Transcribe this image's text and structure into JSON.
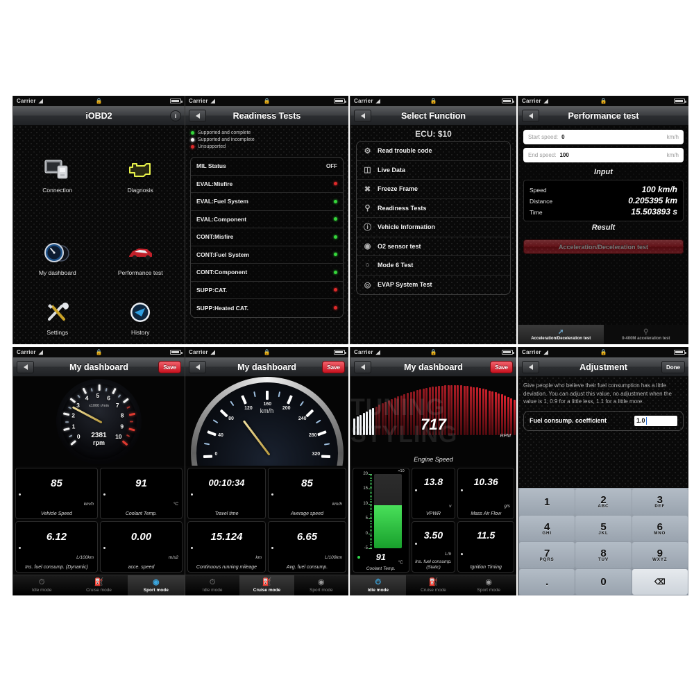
{
  "panels": {
    "home": {
      "status": {
        "carrier": "Carrier",
        "wifi": "wifi-icon",
        "lock": "lock-icon",
        "battery": "battery-icon"
      },
      "title": "iOBD2",
      "info_button": "i",
      "items": [
        {
          "label": "Connection",
          "icon": "connection-icon"
        },
        {
          "label": "Diagnosis",
          "icon": "engine-check-icon"
        },
        {
          "label": "My dashboard",
          "icon": "dashboard-gauge-icon"
        },
        {
          "label": "Performance test",
          "icon": "red-car-icon"
        },
        {
          "label": "Settings",
          "icon": "tools-icon"
        },
        {
          "label": "History",
          "icon": "history-gauge-icon"
        }
      ]
    },
    "readiness": {
      "status": {
        "carrier": "Carrier"
      },
      "title": "Readiness Tests",
      "legend": [
        {
          "label": "Supported and complete",
          "state": "g"
        },
        {
          "label": "Supported and incomplete",
          "state": "w"
        },
        {
          "label": "Unsupported",
          "state": "r"
        }
      ],
      "rows": [
        {
          "label": "MIL Status",
          "value": "OFF",
          "state": ""
        },
        {
          "label": "EVAL:Misfire",
          "value": "",
          "state": "r"
        },
        {
          "label": "EVAL:Fuel System",
          "value": "",
          "state": "g"
        },
        {
          "label": "EVAL:Component",
          "value": "",
          "state": "g"
        },
        {
          "label": "CONT:Misfire",
          "value": "",
          "state": "g"
        },
        {
          "label": "CONT:Fuel System",
          "value": "",
          "state": "g"
        },
        {
          "label": "CONT:Component",
          "value": "",
          "state": "g"
        },
        {
          "label": "SUPP:CAT.",
          "value": "",
          "state": "r"
        },
        {
          "label": "SUPP:Heated CAT.",
          "value": "",
          "state": "r"
        }
      ]
    },
    "select_function": {
      "title": "Select Function",
      "ecu": "ECU: $10",
      "items": [
        {
          "label": "Read trouble code",
          "icon": "trouble-code-icon"
        },
        {
          "label": "Live Data",
          "icon": "live-data-icon"
        },
        {
          "label": "Freeze Frame",
          "icon": "freeze-frame-icon"
        },
        {
          "label": "Readiness Tests",
          "icon": "readiness-icon"
        },
        {
          "label": "Vehicle Information",
          "icon": "vehicle-info-icon"
        },
        {
          "label": "O2 sensor test",
          "icon": "o2-sensor-icon"
        },
        {
          "label": "Mode 6 Test",
          "icon": "mode6-icon"
        },
        {
          "label": "EVAP System Test",
          "icon": "evap-icon"
        }
      ]
    },
    "performance": {
      "title": "Performance test",
      "start_speed_label": "Start speed:",
      "start_speed_value": "0",
      "start_speed_unit": "km/h",
      "end_speed_label": "End speed:",
      "end_speed_value": "100",
      "end_speed_unit": "km/h",
      "input_heading": "Input",
      "results": [
        {
          "key": "Speed",
          "value": "100 km/h"
        },
        {
          "key": "Distance",
          "value": "0.205395 km"
        },
        {
          "key": "Time",
          "value": "15.503893 s"
        }
      ],
      "result_heading": "Result",
      "action_button": "Acceleration/Deceleration test",
      "tabs": [
        {
          "label": "Acceleration/Deceleration test",
          "active": true
        },
        {
          "label": "0-400M acceleration test",
          "active": false
        }
      ]
    },
    "dash_sport": {
      "title": "My dashboard",
      "save_label": "Save",
      "gauge": {
        "type": "tachometer",
        "value": "2381",
        "unit": "rpm",
        "scale_label": "x1000 r/min",
        "ticks": [
          "0",
          "1",
          "2",
          "3",
          "4",
          "5",
          "6",
          "7",
          "8",
          "9",
          "10"
        ],
        "min": 0,
        "max": 10,
        "redline": 7.5,
        "needle_value": 2.381
      },
      "cells": [
        {
          "value": "85",
          "unit": "km/h",
          "caption": "Vehicle Speed"
        },
        {
          "value": "91",
          "unit": "°C",
          "caption": "Coolant Temp."
        },
        {
          "value": "6.12",
          "unit": "L/100km",
          "caption": "Ins. fuel consump. (Dynamic)"
        },
        {
          "value": "0.00",
          "unit": "m/s2",
          "caption": "acce. speed"
        }
      ],
      "tabs": [
        {
          "label": "Idle mode",
          "icon": "idle-icon",
          "active": false
        },
        {
          "label": "Cruise mode",
          "icon": "fuel-icon",
          "active": false
        },
        {
          "label": "Sport mode",
          "icon": "sport-icon",
          "active": true
        }
      ]
    },
    "dash_cruise": {
      "title": "My dashboard",
      "save_label": "Save",
      "gauge": {
        "type": "speedometer",
        "unit": "km/h",
        "ticks": [
          "0",
          "40",
          "80",
          "120",
          "160",
          "200",
          "240",
          "280",
          "320"
        ],
        "min": 0,
        "max": 320,
        "needle_value": 85
      },
      "cells": [
        {
          "value": "00:10:34",
          "unit": "",
          "caption": "Travel time"
        },
        {
          "value": "85",
          "unit": "km/h",
          "caption": "Average speed"
        },
        {
          "value": "15.124",
          "unit": "km",
          "caption": "Continuous running mileage"
        },
        {
          "value": "6.65",
          "unit": "L/100km",
          "caption": "Avg. fuel consump."
        }
      ],
      "tabs": [
        {
          "label": "Idle mode",
          "icon": "idle-icon",
          "active": false
        },
        {
          "label": "Cruise mode",
          "icon": "fuel-icon",
          "active": true
        },
        {
          "label": "Sport mode",
          "icon": "sport-icon",
          "active": false
        }
      ]
    },
    "dash_idle": {
      "title": "My dashboard",
      "save_label": "Save",
      "arc": {
        "value": "717",
        "unit": "RPM",
        "caption": "Engine Speed",
        "fill_ratio": 0.12
      },
      "bar": {
        "value": "91",
        "unit": "°C",
        "caption": "Coolant Temp.",
        "multiplier": "×10",
        "ticks": [
          "20",
          "15",
          "10",
          "5",
          "0",
          "-5"
        ],
        "min": -5,
        "max": 20,
        "fill_ratio": 0.58
      },
      "cells": [
        {
          "value": "13.8",
          "unit": "v",
          "caption": "VPWR"
        },
        {
          "value": "10.36",
          "unit": "g/s",
          "caption": "Mass Air Flow"
        },
        {
          "value": "3.50",
          "unit": "L/h",
          "caption": "Ins. fuel consump.(Static)"
        },
        {
          "value": "11.5",
          "unit": "",
          "caption": "Ignition Timing"
        }
      ],
      "tabs": [
        {
          "label": "Idle mode",
          "icon": "idle-icon",
          "active": true
        },
        {
          "label": "Cruise mode",
          "icon": "fuel-icon",
          "active": false
        },
        {
          "label": "Sport mode",
          "icon": "sport-icon",
          "active": false
        }
      ]
    },
    "adjustment": {
      "title": "Adjustment",
      "done_label": "Done",
      "description": "Give people who believe their fuel consumption has a little deviation. You can adjust this value, no adjustment when the value is 1, 0.9 for a little less,  1.1 for a little more.",
      "field_label": "Fuel consump. coefficient",
      "field_value": "1.0",
      "keys": [
        {
          "main": "1",
          "sub": ""
        },
        {
          "main": "2",
          "sub": "ABC"
        },
        {
          "main": "3",
          "sub": "DEF"
        },
        {
          "main": "4",
          "sub": "GHI"
        },
        {
          "main": "5",
          "sub": "JKL"
        },
        {
          "main": "6",
          "sub": "MNO"
        },
        {
          "main": "7",
          "sub": "PQRS"
        },
        {
          "main": "8",
          "sub": "TUV"
        },
        {
          "main": "9",
          "sub": "WXYZ"
        },
        {
          "main": ".",
          "sub": ""
        },
        {
          "main": "0",
          "sub": ""
        },
        {
          "main": "⌫",
          "sub": ""
        }
      ]
    }
  },
  "watermark": "TUNING STYLING",
  "colors": {
    "accent_red": "#c8121f",
    "status_green": "#35d73b",
    "status_red": "#e02a2a",
    "gauge_gold": "#e6d08a"
  }
}
